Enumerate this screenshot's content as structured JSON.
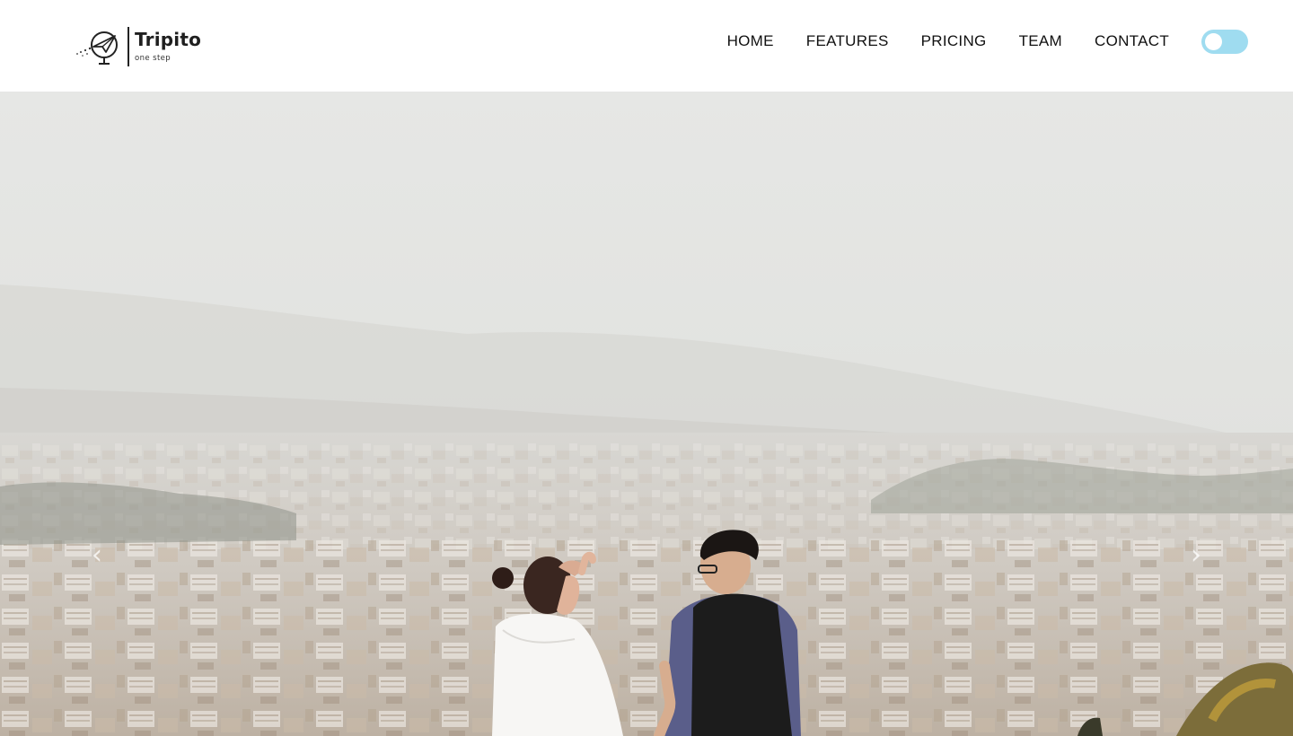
{
  "brand": {
    "name": "Tripito",
    "tagline": "one step"
  },
  "nav": {
    "items": [
      {
        "label": "HOME"
      },
      {
        "label": "FEATURES"
      },
      {
        "label": "PRICING"
      },
      {
        "label": "TEAM"
      },
      {
        "label": "CONTACT"
      }
    ]
  },
  "theme_toggle": {
    "state": "off",
    "accent_color": "#9fdcf0"
  },
  "hero": {
    "image_description_icon": "photo-icon",
    "carousel": {
      "prev_icon": "chevron-left-icon",
      "next_icon": "chevron-right-icon",
      "prev_glyph": "‹",
      "next_glyph": "›"
    }
  },
  "colors": {
    "header_bg": "#ffffff",
    "nav_text": "#111111",
    "sky": "#e9eae8",
    "haze": "#dcdcd8"
  }
}
